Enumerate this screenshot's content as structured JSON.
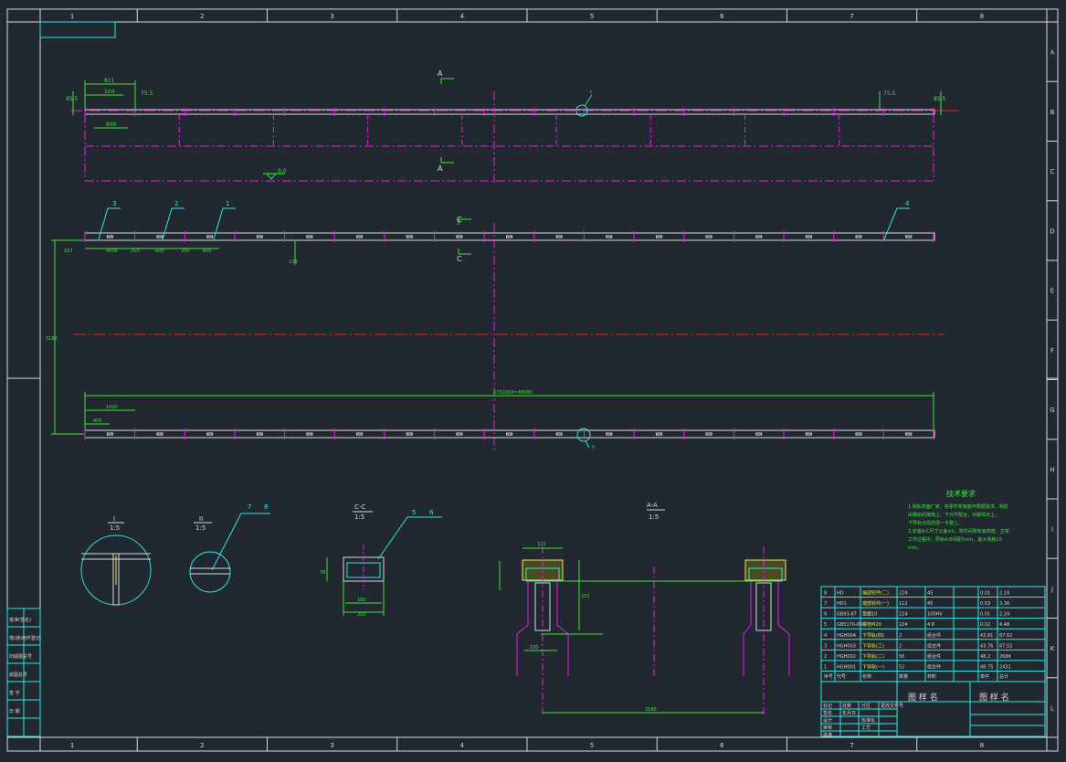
{
  "frame": {
    "col_labels": [
      "1",
      "2",
      "3",
      "4",
      "5",
      "6",
      "7",
      "8"
    ],
    "row_labels": [
      "A",
      "B",
      "C",
      "D",
      "E",
      "F",
      "G",
      "H",
      "I",
      "J",
      "K",
      "L"
    ]
  },
  "colors": {
    "background": "#212830",
    "frame": "#d9d9d9",
    "outline": "#2ee6e6",
    "dimension": "#39e639",
    "center_line": "#e61ee6",
    "axis_line": "#e61e1e",
    "highlight": "#e8e84a"
  },
  "plan_view": {
    "section_mark_top": "A",
    "section_mark_bottom": "A",
    "dim_top_total": "811",
    "dim_top_a": "104",
    "dim_top_b": "600",
    "dim_left_end": "85.5",
    "dim_right_end": "85.5",
    "dim_gap_left": "75.5",
    "dim_gap_right": "75.5",
    "detail_ref_I": "I",
    "level_mark": "0.0"
  },
  "rail_view_1": {
    "callouts": [
      "3",
      "2",
      "1",
      "4"
    ],
    "section_mark_top": "C",
    "section_mark_bottom": "C",
    "dims": [
      "107",
      "4000",
      "250",
      "600",
      "200",
      "800"
    ],
    "offset_dim": "138",
    "overall_height_dim": "3180"
  },
  "rail_view_2": {
    "overall_length": "67X2000=48690",
    "dim_a": "1000",
    "dim_b": "405",
    "detail_ref_II": "II"
  },
  "details": {
    "detail_I": {
      "label": "I",
      "scale": "1:5"
    },
    "detail_II": {
      "label": "II",
      "scale": "1:5",
      "callout_a": "7",
      "callout_b": "8"
    },
    "section_CC": {
      "label": "C-C",
      "scale": "1:5",
      "callout_a": "5",
      "callout_b": "6",
      "dim_w": "180",
      "dim_w2": "202",
      "dim_h": "78"
    },
    "section_AA": {
      "label": "A-A",
      "scale": "1:5",
      "dim_top": "122",
      "dim_h": "215",
      "dim_span": "3180",
      "dim_small": "100"
    }
  },
  "notes": {
    "title": "技术要求",
    "lines": [
      "1.钢轨表面厂家、各零件安装面可根据需求，相应",
      "   由钢轨的接缝上、下对齐配合，对接焊点上。",
      "   下导轨分段前清一平整上。",
      "2.安装A-C尺寸公差±5，零件间隙安装高度，正常",
      "   工作过程中，导轨A-B间距5mm，最大误差10",
      "   mm，"
    ]
  },
  "bom": {
    "rows": [
      {
        "no": "8",
        "code": "HD",
        "name": "端部铰件(二)",
        "qty": "224",
        "mat": "45",
        "w1": "0.01",
        "w2": "2.24"
      },
      {
        "no": "7",
        "code": "HD1",
        "name": "端部铰件(一)",
        "qty": "112",
        "mat": "45",
        "w1": "0.03",
        "w2": "3.36"
      },
      {
        "no": "6",
        "code": "GB93-87",
        "name": "垫圈10",
        "qty": "224",
        "mat": "100HV",
        "w1": "0.01",
        "w2": "2.24"
      },
      {
        "no": "5",
        "code": "GB5170-86",
        "name": "螺栓M20",
        "qty": "224",
        "mat": "4.8",
        "w1": "0.02",
        "w2": "4.48"
      },
      {
        "no": "4",
        "code": "HGH004",
        "name": "下导轨(四)",
        "qty": "2",
        "mat": "组合件",
        "w1": "43.81",
        "w2": "87.62"
      },
      {
        "no": "3",
        "code": "HGH003",
        "name": "下导轨(三)",
        "qty": "2",
        "mat": "组合件",
        "w1": "43.76",
        "w2": "87.52"
      },
      {
        "no": "2",
        "code": "HGH002",
        "name": "下导轨(二)",
        "qty": "56",
        "mat": "组合件",
        "w1": "48.2",
        "w2": "2684"
      },
      {
        "no": "1",
        "code": "HGH001",
        "name": "下导轨(一)",
        "qty": "52",
        "mat": "组合件",
        "w1": "48.75",
        "w2": "2431"
      }
    ],
    "header": [
      "序号",
      "代号",
      "名称",
      "数量",
      "材料",
      "单件",
      "总计"
    ]
  },
  "title_block": {
    "company": "图 样 名",
    "drawing_title": "图  样  名",
    "fields": [
      "标记",
      "处数",
      "分区",
      "更改文件号",
      "签名",
      "年月日",
      "设计",
      "标准化",
      "审核",
      "工艺",
      "批准"
    ]
  },
  "left_strip": {
    "items": [
      "批准(签名)",
      "借(通)用件登记",
      "旧底图总号",
      "底图总号",
      "签 字",
      "日 期"
    ]
  }
}
